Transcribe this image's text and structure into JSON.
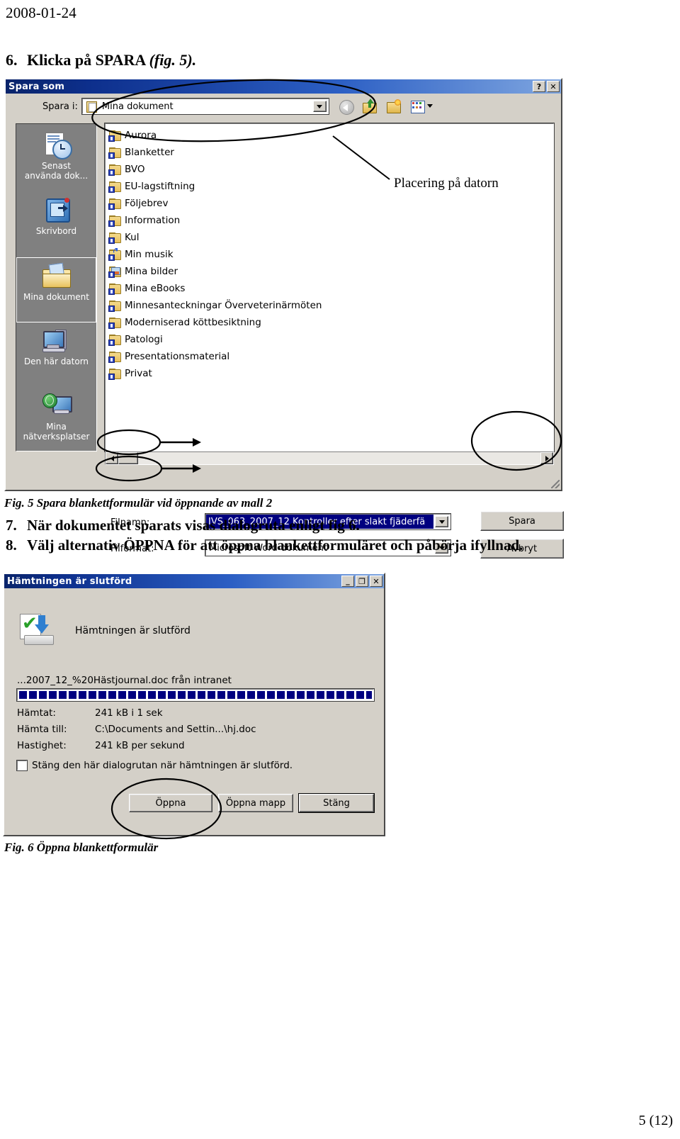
{
  "document": {
    "date": "2008-01-24",
    "page_number": "5 (12)",
    "step6": {
      "number": "6.",
      "text": "Klicka på SPARA ",
      "italic": "(fig. 5)."
    },
    "fig5_caption": "Fig. 5 Spara blankettformulär vid öppnande av mall 2",
    "fig6_caption": "Fig. 6 Öppna blankettformulär",
    "step7": {
      "number": "7.",
      "text": "När dokumentet sparats visas dialogruta enligt fig 6."
    },
    "step8": {
      "number": "8.",
      "text": "Välj alternativ ÖPPNA för att öppna blankettformuläret och påbörja ifyllnad."
    }
  },
  "annotations": {
    "placering": "Placering på datorn"
  },
  "save_dialog": {
    "title": "Spara som",
    "titlebar_buttons": {
      "help": "?",
      "close": "✕"
    },
    "save_in_label": "Spara i:",
    "save_in_value": "Mina dokument",
    "toolbar_icons": [
      "back-icon",
      "up-one-level-icon",
      "new-folder-icon",
      "views-icon"
    ],
    "places": [
      {
        "label": "Senast\nanvända dok...",
        "icon": "recent-documents-icon",
        "selected": false
      },
      {
        "label": "Skrivbord",
        "icon": "desktop-icon",
        "selected": false
      },
      {
        "label": "Mina dokument",
        "icon": "my-documents-icon",
        "selected": true
      },
      {
        "label": "Den här datorn",
        "icon": "my-computer-icon",
        "selected": false
      },
      {
        "label": "Mina\nnätverksplatser",
        "icon": "my-network-places-icon",
        "selected": false
      }
    ],
    "folders": [
      {
        "name": "Aurora",
        "icon": "folder-icon"
      },
      {
        "name": "Blanketter",
        "icon": "folder-icon"
      },
      {
        "name": "BVO",
        "icon": "folder-icon"
      },
      {
        "name": "EU-lagstiftning",
        "icon": "folder-icon"
      },
      {
        "name": "Följebrev",
        "icon": "folder-icon"
      },
      {
        "name": "Information",
        "icon": "folder-icon"
      },
      {
        "name": "Kul",
        "icon": "folder-icon"
      },
      {
        "name": "Min musik",
        "icon": "music-folder-icon"
      },
      {
        "name": "Mina bilder",
        "icon": "pictures-folder-icon"
      },
      {
        "name": "Mina eBooks",
        "icon": "folder-icon"
      },
      {
        "name": "Minnesanteckningar Överveterinärmöten",
        "icon": "folder-icon"
      },
      {
        "name": "Moderniserad köttbesiktning",
        "icon": "folder-icon"
      },
      {
        "name": "Patologi",
        "icon": "folder-icon"
      },
      {
        "name": "Presentationsmaterial",
        "icon": "folder-icon"
      },
      {
        "name": "Privat",
        "icon": "folder-icon"
      }
    ],
    "filename_label": "Filnamn:",
    "filename_value": "IVS_063_2007_12 Kontroller efter slakt fjäderfä",
    "filetype_label": "Filformat:",
    "filetype_value": "Microsoft Word-dokument",
    "save_button": "Spara",
    "cancel_button": "Avbryt"
  },
  "download_dialog": {
    "title": "Hämtningen är slutförd",
    "titlebar_buttons": {
      "minimize": "_",
      "maximize": "❐",
      "close": "✕"
    },
    "heading": "Hämtningen är slutförd",
    "file_line": "...2007_12_%20Hästjournal.doc från intranet",
    "progress_percent": 100,
    "rows": [
      {
        "label": "Hämtat:",
        "value": "241 kB i 1 sek"
      },
      {
        "label": "Hämta till:",
        "value": "C:\\Documents and Settin...\\hj.doc"
      },
      {
        "label": "Hastighet:",
        "value": "241 kB per sekund"
      }
    ],
    "checkbox_label": "Stäng den här dialogrutan när hämtningen är slutförd.",
    "checkbox_checked": false,
    "buttons": {
      "open": "Öppna",
      "open_folder": "Öppna mapp",
      "close": "Stäng"
    }
  },
  "colors": {
    "titlebar_start": "#0a246a",
    "titlebar_end": "#7fa6e0",
    "dialog_face": "#d4d0c8",
    "selection": "#000080",
    "progress": "#000080"
  }
}
